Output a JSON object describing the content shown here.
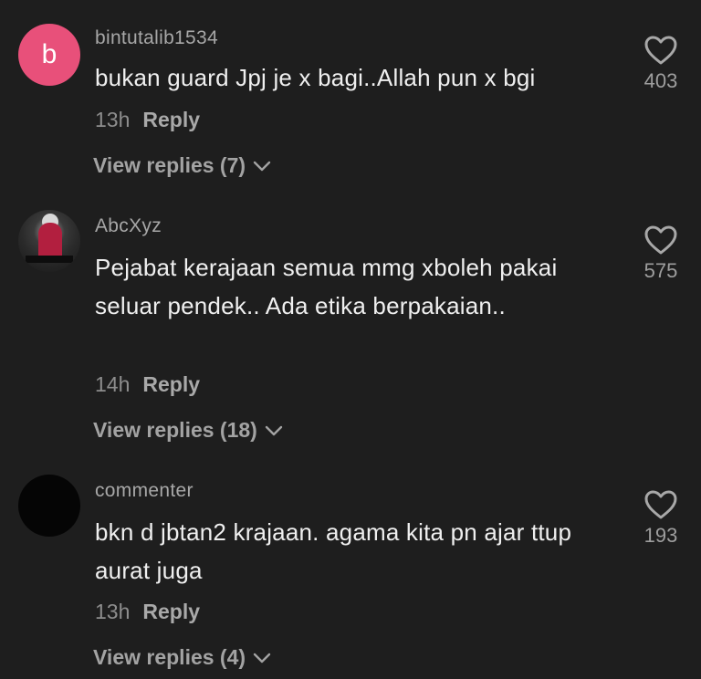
{
  "comments": [
    {
      "username": "bintutalib1534",
      "avatar_letter": "b",
      "avatar_color": "#e8507a",
      "text": "bukan guard Jpj je x bagi..Allah pun x bgi",
      "time": "13h",
      "reply_label": "Reply",
      "view_replies": "View replies (7)",
      "likes": "403",
      "like_icon": "heart-outline-icon"
    },
    {
      "username": "AbcXyz",
      "text": "Pejabat kerajaan semua mmg xboleh pakai seluar pendek.. Ada etika berpakaian..",
      "time": "14h",
      "reply_label": "Reply",
      "view_replies": "View replies (18)",
      "likes": "575",
      "like_icon": "heart-outline-icon"
    },
    {
      "username": "commenter",
      "text": "bkn d jbtan2 krajaan. agama kita pn ajar ttup aurat juga",
      "time": "13h",
      "reply_label": "Reply",
      "view_replies": "View replies (4)",
      "likes": "193",
      "like_icon": "heart-outline-icon"
    }
  ],
  "colors": {
    "background": "#1e1e1e",
    "text": "#efefef",
    "muted": "#a7a7a7"
  }
}
